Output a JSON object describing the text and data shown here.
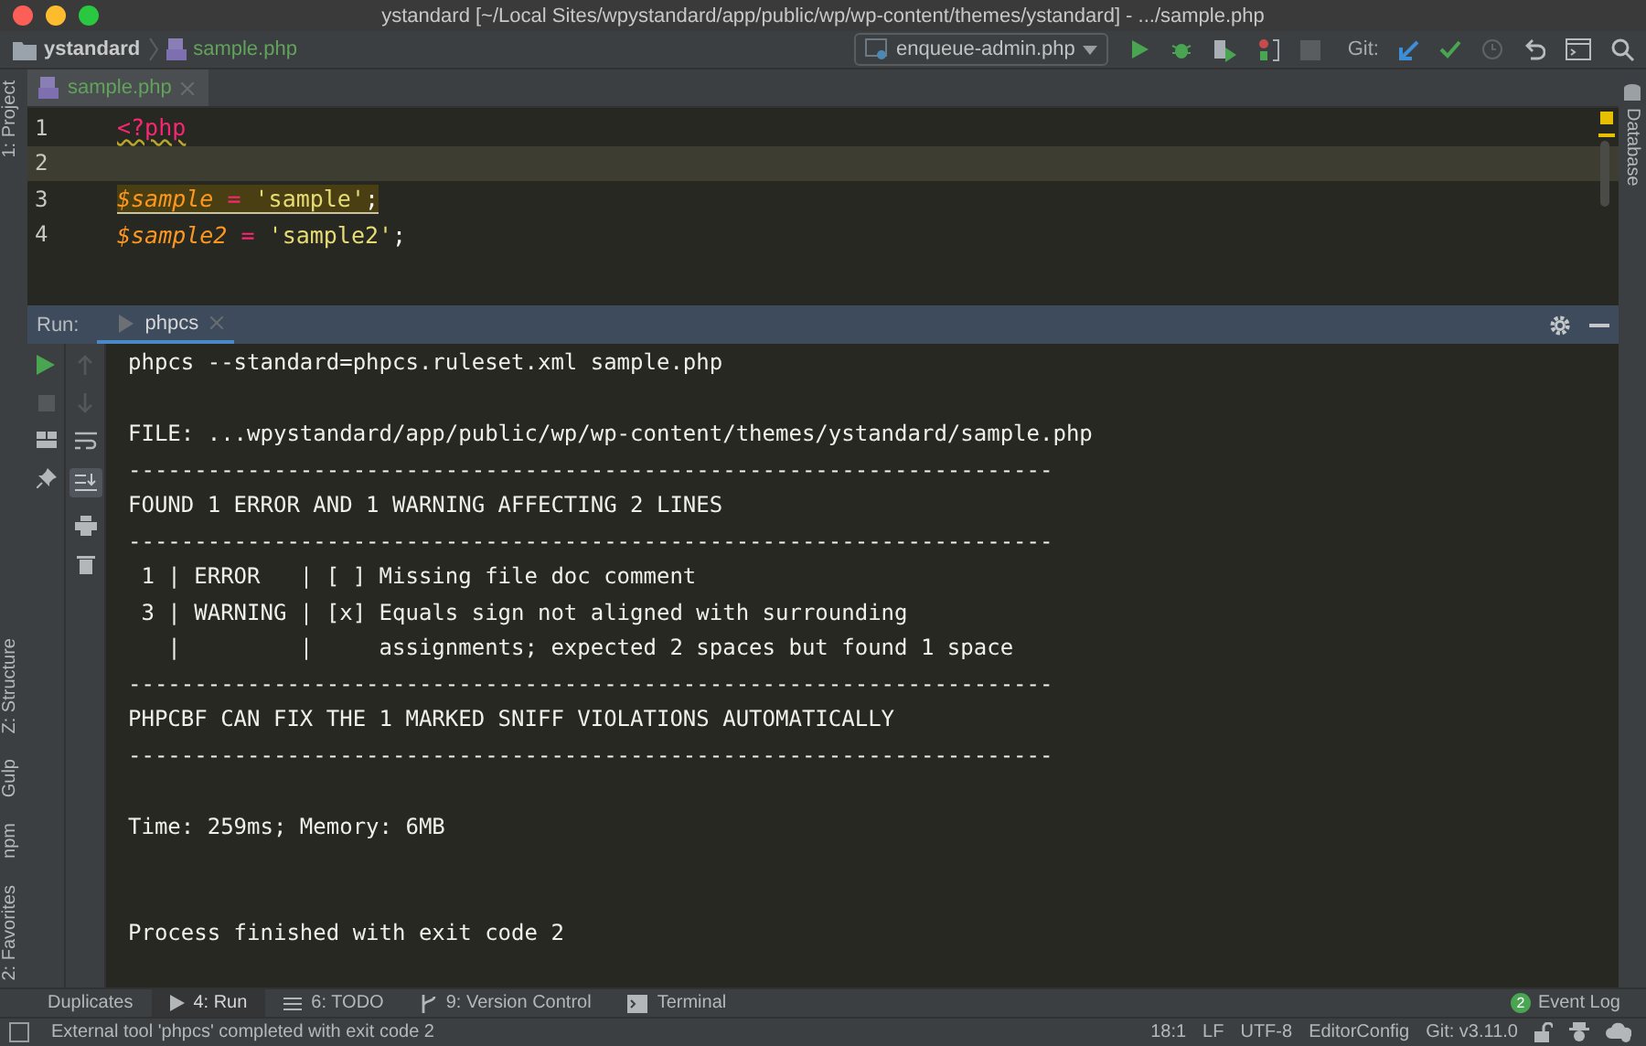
{
  "window": {
    "title": "ystandard [~/Local Sites/wpystandard/app/public/wp/wp-content/themes/ystandard] - .../sample.php"
  },
  "breadcrumb": [
    {
      "kind": "folder",
      "label": "ystandard"
    },
    {
      "kind": "file",
      "label": "sample.php"
    }
  ],
  "toolbar": {
    "run_config": "enqueue-admin.php",
    "git_label": "Git:"
  },
  "left_strip": [
    {
      "label": "1: Project",
      "kind": "top"
    },
    {
      "label": "Z: Structure",
      "kind": "bottom"
    },
    {
      "label": "Gulp",
      "kind": "bottom"
    },
    {
      "label": "npm",
      "kind": "bottom"
    },
    {
      "label": "2: Favorites",
      "kind": "bottom"
    }
  ],
  "right_strip": [
    {
      "label": "Database"
    }
  ],
  "editor_tabs": [
    {
      "label": "sample.php",
      "selected": true
    }
  ],
  "code_lines": [
    {
      "number": "1",
      "current": false,
      "warning": false,
      "tokens": [
        {
          "kind": "tag",
          "text": "<?php"
        }
      ]
    },
    {
      "number": "2",
      "current": true,
      "warning": false
    },
    {
      "number": "3",
      "current": false,
      "warning": true,
      "tokens": [
        {
          "kind": "var",
          "text": "$sample"
        },
        {
          "kind": "op",
          "text": " = "
        },
        {
          "kind": "str",
          "text": "'sample'"
        },
        {
          "kind": "punct",
          "text": ";"
        }
      ]
    },
    {
      "number": "4",
      "current": false,
      "warning": false,
      "tokens": [
        {
          "kind": "var",
          "text": "$sample2"
        },
        {
          "kind": "op",
          "text": " = "
        },
        {
          "kind": "str",
          "text": "'sample2'"
        },
        {
          "kind": "punct",
          "text": ";"
        }
      ]
    }
  ],
  "run_panel": {
    "label": "Run:",
    "tabs": [
      {
        "label": "phpcs",
        "selected": true
      }
    ]
  },
  "console": [
    {
      "kind": "text",
      "text": "phpcs --standard=phpcs.ruleset.xml sample.php"
    },
    {
      "kind": "blank"
    },
    {
      "kind": "text",
      "text": "FILE: ...wpystandard/app/public/wp/wp-content/themes/ystandard/sample.php"
    },
    {
      "kind": "text",
      "text": "----------------------------------------------------------------------"
    },
    {
      "kind": "text",
      "text": "FOUND 1 ERROR AND 1 WARNING AFFECTING 2 LINES"
    },
    {
      "kind": "text",
      "text": "----------------------------------------------------------------------"
    },
    {
      "kind": "text",
      "text": " 1 | ERROR   | [ ] Missing file doc comment"
    },
    {
      "kind": "text",
      "text": " 3 | WARNING | [x] Equals sign not aligned with surrounding"
    },
    {
      "kind": "text",
      "text": "   |         |     assignments; expected 2 spaces but found 1 space"
    },
    {
      "kind": "text",
      "text": "----------------------------------------------------------------------"
    },
    {
      "kind": "text",
      "text": "PHPCBF CAN FIX THE 1 MARKED SNIFF VIOLATIONS AUTOMATICALLY"
    },
    {
      "kind": "text",
      "text": "----------------------------------------------------------------------"
    },
    {
      "kind": "blank"
    },
    {
      "kind": "text",
      "text": "Time: 259ms; Memory: 6MB"
    },
    {
      "kind": "blank"
    },
    {
      "kind": "blank"
    },
    {
      "kind": "text",
      "text": "Process finished with exit code 2"
    }
  ],
  "tool_tabs": [
    {
      "label": "Duplicates",
      "kind": "plain",
      "selected": false
    },
    {
      "label": "4: Run",
      "kind": "run",
      "selected": true
    },
    {
      "label": "6: TODO",
      "kind": "todo",
      "selected": false
    },
    {
      "label": "9: Version Control",
      "kind": "vcs",
      "selected": false
    },
    {
      "label": "Terminal",
      "kind": "terminal",
      "selected": false
    }
  ],
  "event_log": {
    "count": "2",
    "label": "Event Log"
  },
  "status_bar": {
    "message": "External tool 'phpcs' completed with exit code 2",
    "items": [
      "18:1",
      "LF",
      "UTF-8",
      "EditorConfig",
      "Git: v3.11.0"
    ]
  }
}
